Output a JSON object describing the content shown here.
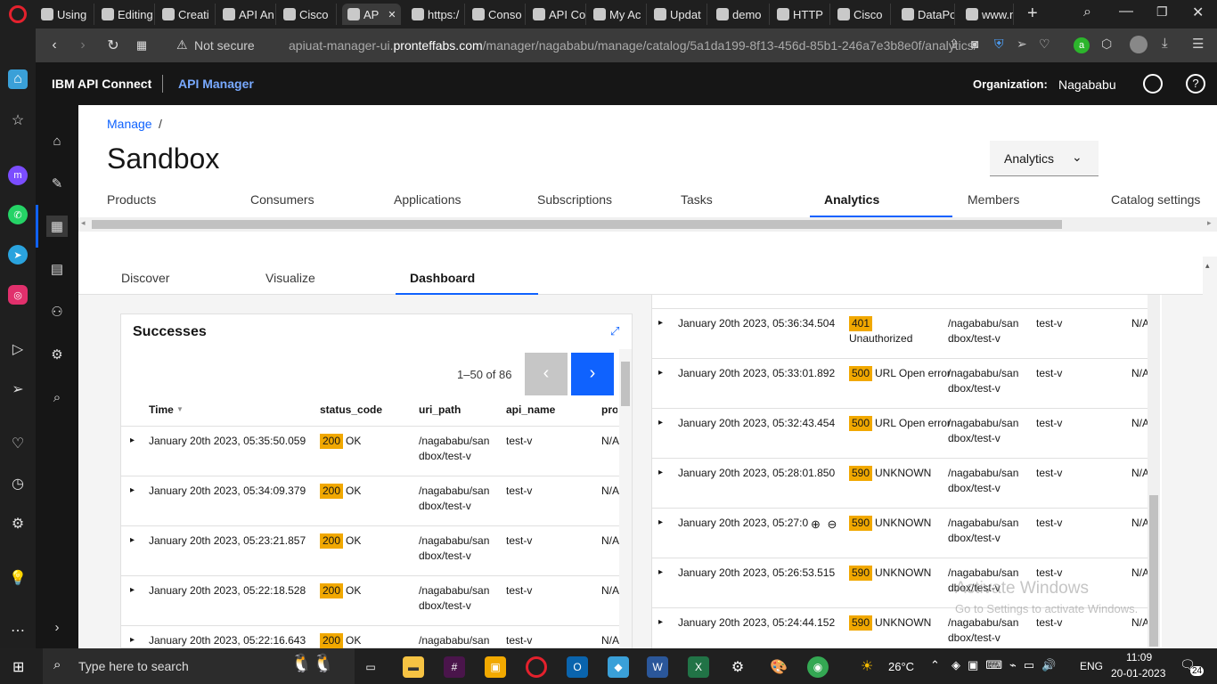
{
  "browser": {
    "tabs": [
      {
        "label": "Using"
      },
      {
        "label": "Editing"
      },
      {
        "label": "Creati"
      },
      {
        "label": "API An"
      },
      {
        "label": "Cisco"
      },
      {
        "label": "AP"
      },
      {
        "label": "https:/"
      },
      {
        "label": "Conso"
      },
      {
        "label": "API Co"
      },
      {
        "label": "My Ac"
      },
      {
        "label": "Updat"
      },
      {
        "label": "demo"
      },
      {
        "label": "HTTP"
      },
      {
        "label": "Cisco"
      },
      {
        "label": "DataPo"
      },
      {
        "label": "www.n"
      }
    ],
    "security_label": "Not secure",
    "url_host": "apiuat-manager-ui.pronteffabs.com",
    "url_prefix": "apiuat-manager-ui.",
    "url_rest": "/manager/nagababu/manage/catalog/5a1da199-8f13-456d-85b1-246a7e3b8e0f/analytics/"
  },
  "header": {
    "brand": "IBM API Connect",
    "product": "API Manager",
    "org_label": "Organization:",
    "org_value": "Nagababu"
  },
  "page": {
    "breadcrumb": "Manage",
    "breadcrumb_sep": "/",
    "title": "Sandbox",
    "analytics_dropdown": "Analytics",
    "tabs": [
      "Products",
      "Consumers",
      "Applications",
      "Subscriptions",
      "Tasks",
      "Analytics",
      "Members",
      "Catalog settings"
    ],
    "subtabs": [
      "Discover",
      "Visualize",
      "Dashboard"
    ]
  },
  "successes": {
    "title": "Successes",
    "pagination": "1–50 of 86",
    "columns": [
      "Time",
      "status_code",
      "uri_path",
      "api_name",
      "pro"
    ],
    "rows": [
      {
        "time": "January 20th 2023, 05:35:50.059",
        "code": "200",
        "status": "OK",
        "uri1": "/nagababu/san",
        "uri2": "dbox/test-v",
        "api": "test-v",
        "pro": "N/A"
      },
      {
        "time": "January 20th 2023, 05:34:09.379",
        "code": "200",
        "status": "OK",
        "uri1": "/nagababu/san",
        "uri2": "dbox/test-v",
        "api": "test-v",
        "pro": "N/A"
      },
      {
        "time": "January 20th 2023, 05:23:21.857",
        "code": "200",
        "status": "OK",
        "uri1": "/nagababu/san",
        "uri2": "dbox/test-v",
        "api": "test-v",
        "pro": "N/A"
      },
      {
        "time": "January 20th 2023, 05:22:18.528",
        "code": "200",
        "status": "OK",
        "uri1": "/nagababu/san",
        "uri2": "dbox/test-v",
        "api": "test-v",
        "pro": "N/A"
      },
      {
        "time": "January 20th 2023, 05:22:16.643",
        "code": "200",
        "status": "OK",
        "uri1": "/nagababu/san",
        "uri2": "",
        "api": "test-v",
        "pro": "N/A"
      }
    ]
  },
  "errors": {
    "rows": [
      {
        "time": "January 20th 2023, 05:36:34.504",
        "code": "401",
        "status": "Unauthorized",
        "uri1": "/nagababu/san",
        "uri2": "dbox/test-v",
        "api": "test-v",
        "pro": "N/A"
      },
      {
        "time": "January 20th 2023, 05:33:01.892",
        "code": "500",
        "status": "URL Open error",
        "uri1": "/nagababu/san",
        "uri2": "dbox/test-v",
        "api": "test-v",
        "pro": "N/A"
      },
      {
        "time": "January 20th 2023, 05:32:43.454",
        "code": "500",
        "status": "URL Open error",
        "uri1": "/nagababu/san",
        "uri2": "dbox/test-v",
        "api": "test-v",
        "pro": "N/A"
      },
      {
        "time": "January 20th 2023, 05:28:01.850",
        "code": "590",
        "status": "UNKNOWN",
        "uri1": "/nagababu/san",
        "uri2": "dbox/test-v",
        "api": "test-v",
        "pro": "N/A"
      },
      {
        "time": "January 20th 2023, 05:27:0",
        "code": "590",
        "status": "UNKNOWN",
        "uri1": "/nagababu/san",
        "uri2": "dbox/test-v",
        "api": "test-v",
        "pro": "N/A"
      },
      {
        "time": "January 20th 2023, 05:26:53.515",
        "code": "590",
        "status": "UNKNOWN",
        "uri1": "/nagababu/san",
        "uri2": "dbox/test-v",
        "api": "test-v",
        "pro": "N/A"
      },
      {
        "time": "January 20th 2023, 05:24:44.152",
        "code": "590",
        "status": "UNKNOWN",
        "uri1": "/nagababu/san",
        "uri2": "dbox/test-v",
        "api": "test-v",
        "pro": "N/A"
      }
    ]
  },
  "watermark": {
    "line1": "Activate Windows",
    "line2": "Go to Settings to activate Windows."
  },
  "taskbar": {
    "search_placeholder": "Type here to search",
    "weather": "26°C",
    "lang": "ENG",
    "time": "11:09",
    "date": "20-01-2023",
    "notif_count": "24"
  },
  "colors": {
    "accent": "#0f62fe",
    "badge": "#f1a800",
    "dark_bg": "#161616"
  }
}
